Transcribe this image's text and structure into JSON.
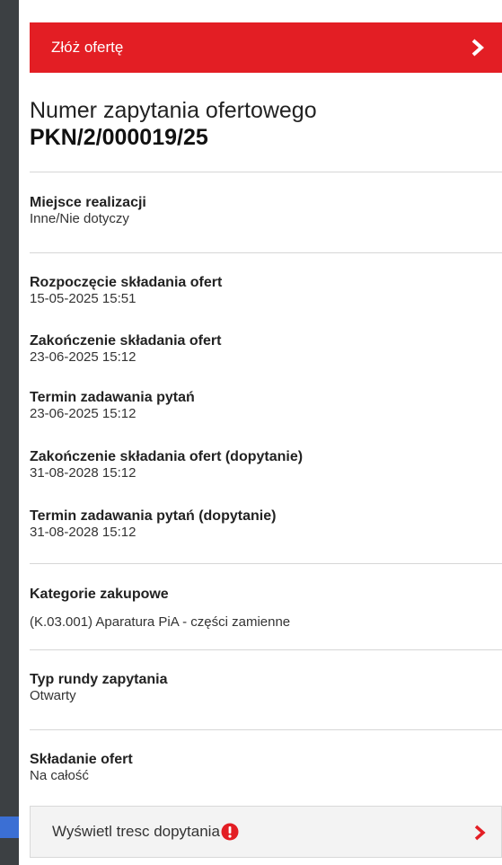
{
  "submit_bar": {
    "label": "Złóż ofertę",
    "color": "#e31e24"
  },
  "header": {
    "title": "Numer zapytania ofertowego",
    "number": "PKN/2/000019/25"
  },
  "fields": {
    "location": {
      "label": "Miejsce realizacji",
      "value": "Inne/Nie dotyczy"
    },
    "start": {
      "label": "Rozpoczęcie składania ofert",
      "value": "15-05-2025 15:51"
    },
    "end": {
      "label": "Zakończenie składania ofert",
      "value": "23-06-2025 15:12"
    },
    "questions": {
      "label": "Termin zadawania pytań",
      "value": "23-06-2025 15:12"
    },
    "end_followup": {
      "label": "Zakończenie składania ofert (dopytanie)",
      "value": "31-08-2028 15:12"
    },
    "questions_followup": {
      "label": "Termin zadawania pytań (dopytanie)",
      "value": "31-08-2028 15:12"
    },
    "categories": {
      "label": "Kategorie zakupowe",
      "value": "(K.03.001) Aparatura PiA - części zamienne"
    },
    "round_type": {
      "label": "Typ rundy zapytania",
      "value": "Otwarty"
    },
    "submission": {
      "label": "Składanie ofert",
      "value": "Na całość"
    }
  },
  "followup_button": {
    "label": "Wyświetl tresc dopytania",
    "alert_icon": "exclamation-icon"
  },
  "icons": {
    "chevron": "chevron-right-icon",
    "pointer": "arrow-pointer-icon"
  }
}
